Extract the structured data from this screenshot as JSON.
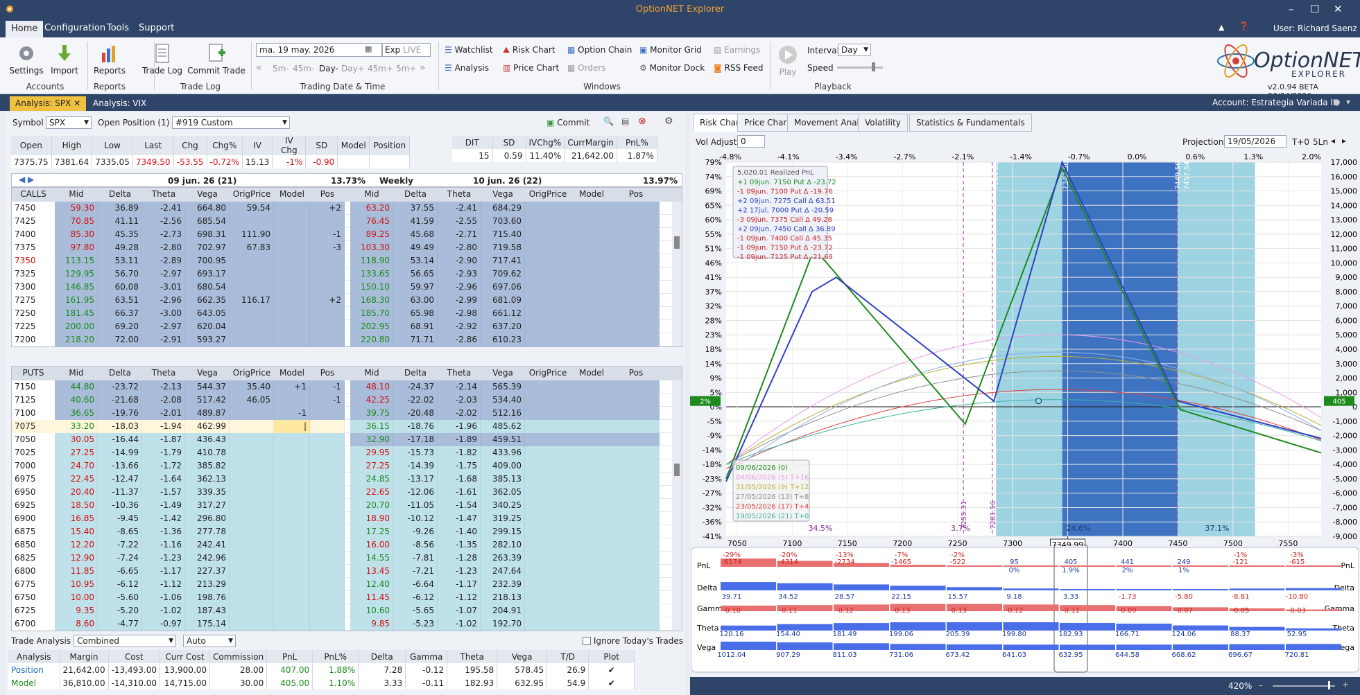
{
  "app": {
    "title": "OptionNET Explorer",
    "user": "User: Richard Saenz",
    "logo": "OptionNET",
    "logo_sub": "EXPLORER",
    "version": "v2.0.94 BETA 23/04/2026"
  },
  "menu": [
    "Home",
    "Configuration",
    "Tools",
    "Support"
  ],
  "ribbon": {
    "accounts": {
      "label": "Accounts",
      "settings": "Settings",
      "import": "Import"
    },
    "reports": {
      "label": "Reports",
      "reports": "Reports"
    },
    "tradelog": {
      "label": "Trade Log",
      "tradelog": "Trade Log",
      "commit": "Commit Trade"
    },
    "trading": {
      "label": "Trading Date & Time",
      "date": "ma. 19 may. 2026",
      "exp": "Exp",
      "live": "LIVE",
      "steps": [
        "5m-",
        "45m-",
        "Day-",
        "Day+",
        "45m+",
        "5m+"
      ]
    },
    "windows": {
      "label": "Windows",
      "watchlist": "Watchlist",
      "analysis": "Analysis",
      "risk": "Risk Chart",
      "price": "Price Chart",
      "chain": "Option Chain",
      "orders": "Orders",
      "grid": "Monitor Grid",
      "dock": "Monitor Dock",
      "earnings": "Earnings",
      "rss": "RSS Feed"
    },
    "playback": {
      "label": "Playback",
      "play": "Play",
      "interval": "Interval",
      "interval_val": "Day",
      "speed": "Speed"
    }
  },
  "doc_tabs": [
    "Analysis: SPX",
    "Analysis: VIX"
  ],
  "account": "Account: Estrategia Variada II",
  "left": {
    "symbol_label": "Symbol",
    "symbol": "SPX",
    "open_pos": "Open Position (1)",
    "pos_name": "#919 Custom",
    "commit": "Commit",
    "quote_headers": [
      "Open",
      "High",
      "Low",
      "Last",
      "Chg",
      "Chg%",
      "IV",
      "IV Chg",
      "SD",
      "Model",
      "Position"
    ],
    "quote_values": [
      "7375.75",
      "7381.64",
      "7335.05",
      "7349.50",
      "-53.55",
      "-0.72%",
      "15.13",
      "-1%",
      "-0.90",
      "",
      ""
    ],
    "stat_headers": [
      "DIT",
      "SD",
      "IVChg%",
      "CurrMargin",
      "PnL%"
    ],
    "stat_values": [
      "15",
      "0.59",
      "11.40%",
      "21,642.00",
      "1.87%"
    ],
    "exp1": "09 jun. 26 (21)",
    "exp1_iv": "13.73%",
    "exp2_label": "Weekly",
    "exp2": "10 jun. 26 (22)",
    "exp2_iv": "13.97%",
    "calls_label": "CALLS",
    "puts_label": "PUTS",
    "col_headers": [
      "Mid",
      "Delta",
      "Theta",
      "Vega",
      "OrigPrice",
      "Model",
      "Pos"
    ],
    "col_headers2": [
      "Mid",
      "Delta",
      "Theta",
      "Vega",
      "OrigPrice",
      "Model",
      "Pos"
    ],
    "calls": [
      [
        "7450",
        "59.30",
        "36.89",
        "-2.41",
        "664.80",
        "59.54",
        "",
        "+2",
        "63.20",
        "37.55",
        "-2.41",
        "684.29"
      ],
      [
        "7425",
        "70.85",
        "41.11",
        "-2.56",
        "685.54",
        "",
        "",
        "",
        "76.45",
        "41.59",
        "-2.55",
        "703.60"
      ],
      [
        "7400",
        "85.30",
        "45.35",
        "-2.73",
        "698.31",
        "111.90",
        "",
        "-1",
        "89.25",
        "45.68",
        "-2.71",
        "715.40"
      ],
      [
        "7375",
        "97.80",
        "49.28",
        "-2.80",
        "702.97",
        "67.83",
        "",
        "-3",
        "103.30",
        "49.49",
        "-2.80",
        "719.58"
      ],
      [
        "7350",
        "113.15",
        "53.11",
        "-2.89",
        "700.95",
        "",
        "",
        "",
        "118.90",
        "53.14",
        "-2.90",
        "717.41"
      ],
      [
        "7325",
        "129.95",
        "56.70",
        "-2.97",
        "693.17",
        "",
        "",
        "",
        "133.65",
        "56.65",
        "-2.93",
        "709.62"
      ],
      [
        "7300",
        "146.85",
        "60.08",
        "-3.01",
        "680.54",
        "",
        "",
        "",
        "150.10",
        "59.97",
        "-2.96",
        "697.06"
      ],
      [
        "7275",
        "161.95",
        "63.51",
        "-2.96",
        "662.35",
        "116.17",
        "",
        "+2",
        "168.30",
        "63.00",
        "-2.99",
        "681.09"
      ],
      [
        "7250",
        "181.45",
        "66.37",
        "-3.00",
        "643.05",
        "",
        "",
        "",
        "185.70",
        "65.98",
        "-2.98",
        "661.12"
      ],
      [
        "7225",
        "200.00",
        "69.20",
        "-2.97",
        "620.04",
        "",
        "",
        "",
        "202.95",
        "68.91",
        "-2.92",
        "637.20"
      ],
      [
        "7200",
        "218.20",
        "72.00",
        "-2.91",
        "593.27",
        "",
        "",
        "",
        "220.80",
        "71.71",
        "-2.86",
        "610.23"
      ],
      [
        "7175",
        "236.20",
        "74.81",
        "-2.80",
        "562.27",
        "",
        "",
        "",
        "240.60",
        "74.11",
        "-2.81",
        "583.85"
      ]
    ],
    "puts": [
      [
        "7150",
        "44.80",
        "-23.72",
        "-2.13",
        "544.37",
        "35.40",
        "+1",
        "-1",
        "48.10",
        "-24.37",
        "-2.14",
        "565.39"
      ],
      [
        "7125",
        "40.60",
        "-21.68",
        "-2.08",
        "517.42",
        "46.05",
        "",
        "-1",
        "42.25",
        "-22.02",
        "-2.03",
        "534.40"
      ],
      [
        "7100",
        "36.65",
        "-19.76",
        "-2.01",
        "489.87",
        "",
        "-1",
        "",
        "39.75",
        "-20.48",
        "-2.02",
        "512.16"
      ],
      [
        "7075",
        "33.20",
        "-18.03",
        "-1.94",
        "462.99",
        "",
        "|",
        "",
        "36.15",
        "-18.76",
        "-1.96",
        "485.62"
      ],
      [
        "7050",
        "30.05",
        "-16.44",
        "-1.87",
        "436.43",
        "",
        "",
        "",
        "32.90",
        "-17.18",
        "-1.89",
        "459.51"
      ],
      [
        "7025",
        "27.25",
        "-14.99",
        "-1.79",
        "410.78",
        "",
        "",
        "",
        "29.95",
        "-15.73",
        "-1.82",
        "433.96"
      ],
      [
        "7000",
        "24.70",
        "-13.66",
        "-1.72",
        "385.82",
        "",
        "",
        "",
        "27.25",
        "-14.39",
        "-1.75",
        "409.00"
      ],
      [
        "6975",
        "22.45",
        "-12.47",
        "-1.64",
        "362.13",
        "",
        "",
        "",
        "24.85",
        "-13.17",
        "-1.68",
        "385.13"
      ],
      [
        "6950",
        "20.40",
        "-11.37",
        "-1.57",
        "339.35",
        "",
        "",
        "",
        "22.65",
        "-12.06",
        "-1.61",
        "362.05"
      ],
      [
        "6925",
        "18.50",
        "-10.36",
        "-1.49",
        "317.27",
        "",
        "",
        "",
        "20.70",
        "-11.05",
        "-1.54",
        "340.25"
      ],
      [
        "6900",
        "16.85",
        "-9.45",
        "-1.42",
        "296.80",
        "",
        "",
        "",
        "18.90",
        "-10.12",
        "-1.47",
        "319.25"
      ],
      [
        "6875",
        "15.40",
        "-8.65",
        "-1.36",
        "277.78",
        "",
        "",
        "",
        "17.25",
        "-9.26",
        "-1.40",
        "299.15"
      ],
      [
        "6850",
        "12.20",
        "-7.22",
        "-1.16",
        "242.41",
        "",
        "",
        "",
        "16.00",
        "-8.56",
        "-1.35",
        "282.10"
      ],
      [
        "6825",
        "12.90",
        "-7.24",
        "-1.23",
        "242.96",
        "",
        "",
        "",
        "14.55",
        "-7.81",
        "-1.28",
        "263.39"
      ],
      [
        "6800",
        "11.85",
        "-6.65",
        "-1.17",
        "227.37",
        "",
        "",
        "",
        "13.45",
        "-7.21",
        "-1.23",
        "247.64"
      ],
      [
        "6775",
        "10.95",
        "-6.12",
        "-1.12",
        "213.29",
        "",
        "",
        "",
        "12.40",
        "-6.64",
        "-1.17",
        "232.39"
      ],
      [
        "6750",
        "10.00",
        "-5.60",
        "-1.06",
        "198.76",
        "",
        "",
        "",
        "11.45",
        "-6.12",
        "-1.12",
        "218.13"
      ],
      [
        "6725",
        "9.35",
        "-5.20",
        "-1.02",
        "187.43",
        "",
        "",
        "",
        "10.60",
        "-5.65",
        "-1.07",
        "204.91"
      ],
      [
        "6700",
        "8.60",
        "-4.77",
        "-0.97",
        "175.14",
        "",
        "",
        "",
        "9.85",
        "-5.23",
        "-1.02",
        "192.70"
      ]
    ],
    "trade": {
      "label": "Trade Analysis",
      "mode": "Combined",
      "auto": "Auto",
      "ignore": "Ignore Today's Trades",
      "headers": [
        "Analysis",
        "Margin",
        "Cost",
        "Curr Cost",
        "Commission",
        "PnL",
        "PnL%",
        "Delta",
        "Gamma",
        "Theta",
        "Vega",
        "T/D",
        "Plot"
      ],
      "rows": [
        [
          "Position",
          "21,642.00",
          "-13,493.00",
          "13,900.00",
          "28.00",
          "407.00",
          "1.88%",
          "7.28",
          "-0.12",
          "195.58",
          "578.45",
          "26.9",
          "✔"
        ],
        [
          "Model",
          "36,810.00",
          "-14,310.00",
          "14,715.00",
          "30.00",
          "405.00",
          "1.10%",
          "3.33",
          "-0.11",
          "182.93",
          "632.95",
          "54.9",
          "✔"
        ]
      ]
    }
  },
  "right": {
    "tabs": [
      "Risk Chart",
      "Price Chart",
      "Movement Analysis",
      "Volatility",
      "Statistics & Fundamentals"
    ],
    "vol_adjust": "Vol Adjust",
    "vol_val": "0",
    "projection": "Projection",
    "proj_date": "19/05/2026",
    "t0": "T+0",
    "ln": "5Ln",
    "zoom": "420%",
    "pct_top": [
      "-4.8%",
      "-4.1%",
      "-3.4%",
      "-2.7%",
      "-2.1%",
      "-1.4%",
      "-0.7%",
      "0.0%",
      "0.6%",
      "1.3%",
      "2.0%"
    ],
    "left_axis": [
      "79%",
      "74%",
      "69%",
      "65%",
      "60%",
      "55%",
      "51%",
      "46%",
      "41%",
      "37%",
      "32%",
      "28%",
      "23%",
      "18%",
      "14%",
      "9%",
      "5%",
      "0%",
      "-5%",
      "-9%",
      "-14%",
      "-18%",
      "-23%",
      "-27%",
      "-32%",
      "-36%",
      "-41%"
    ],
    "right_axis": [
      "17,000",
      "16,000",
      "15,000",
      "14,000",
      "13,000",
      "12,000",
      "11,000",
      "10,000",
      "9,000",
      "8,000",
      "7,000",
      "6,000",
      "5,000",
      "4,000",
      "3,000",
      "2,000",
      "1,000",
      "0",
      "-1,000",
      "-2,000",
      "-3,000",
      "-4,000",
      "-5,000",
      "-6,000",
      "-7,000",
      "-8,000",
      "-9,000"
    ],
    "x_axis": [
      "7050",
      "7100",
      "7150",
      "7200",
      "7250",
      "7300",
      "7350",
      "7400",
      "7450",
      "7500",
      "7550"
    ],
    "last_price": "7349.99",
    "left_marker": "2%",
    "right_marker": "405",
    "legend_title": "5,020.01 Realized PnL",
    "legend": [
      "+1 09jun. 7150 Put Δ -23.72",
      "-1 09jun. 7100 Put Δ -19.76",
      "+2 09jun. 7275 Call Δ 63.51",
      "+2 17jul. 7000 Put Δ -20.59",
      "-3 09jun. 7375 Call Δ 49.28",
      "+2 09jun. 7450 Call Δ 36.89",
      "-1 09jun. 7400 Call Δ 45.35",
      "-1 09jun. 7150 Put Δ -23.72",
      "-1 09jun. 7125 Put Δ -21.68"
    ],
    "dates": [
      "09/06/2026 (0)",
      "04/06/2026 (5) T+16",
      "31/05/2026 (9) T+12",
      "27/05/2026 (13) T+8",
      "23/05/2026 (17) T+4",
      "19/05/2026 (21) T+0"
    ],
    "vlabels": [
      "7255.31",
      "7281.56",
      "7284.06",
      "7347.56",
      "7449.56",
      "7457.54",
      "7522.02"
    ],
    "bottom_pcts": [
      "34.5%",
      "3.7%",
      "24.6%",
      "37.1%"
    ],
    "greeks_labels": [
      "PnL",
      "Delta",
      "Gamma",
      "Theta",
      "Vega"
    ],
    "pnl": [
      "-29%",
      "-20%",
      "-13%",
      "-7%",
      "-2%",
      "",
      "",
      "",
      "",
      "-1%",
      "-3%"
    ],
    "pnl2": [
      "-6174",
      "-4314",
      "-2734",
      "-1465",
      "-522",
      "95",
      "405",
      "441",
      "249",
      "-121",
      "-615"
    ],
    "pnl3": [
      "",
      "",
      "",
      "",
      "",
      "0%",
      "1.9%",
      "2%",
      "1%",
      "",
      ""
    ],
    "delta": [
      "39.71",
      "34.52",
      "28.57",
      "22.15",
      "15.57",
      "9.18",
      "3.33",
      "-1.73",
      "-5.80",
      "-8.81",
      "-10.80"
    ],
    "gamma": [
      "-0.10",
      "-0.11",
      "-0.12",
      "-0.13",
      "-0.13",
      "-0.12",
      "-0.11",
      "-0.09",
      "-0.07",
      "-0.05",
      "-0.03"
    ],
    "theta": [
      "120.16",
      "154.40",
      "181.49",
      "199.06",
      "205.39",
      "199.80",
      "182.93",
      "166.71",
      "124.06",
      "88.37",
      "52.95"
    ],
    "vega": [
      "1012.04",
      "907.29",
      "811.03",
      "731.06",
      "673.42",
      "641.03",
      "632.95",
      "644.58",
      "668.62",
      "696.67",
      "720.81"
    ]
  },
  "colors": {
    "navy": "#2e4468",
    "accent": "#f0c040",
    "green": "#1f8a1f",
    "blue": "#3040c0"
  }
}
